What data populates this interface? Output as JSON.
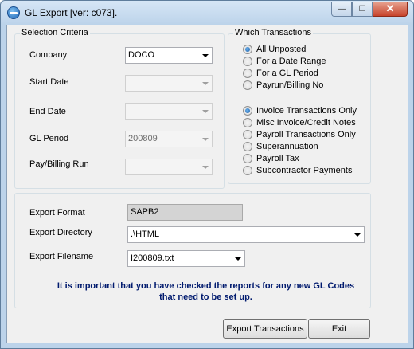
{
  "window": {
    "title": "GL Export [ver: c073].",
    "minimize_glyph": "—",
    "maximize_glyph": "☐",
    "close_glyph": "✕"
  },
  "selection_criteria": {
    "title": "Selection Criteria",
    "company_label": "Company",
    "company_value": "DOCO",
    "start_date_label": "Start Date",
    "start_date_value": "",
    "end_date_label": "End Date",
    "end_date_value": "",
    "gl_period_label": "GL Period",
    "gl_period_value": "200809",
    "pay_billing_run_label": "Pay/Billing Run",
    "pay_billing_run_value": ""
  },
  "which_transactions": {
    "title": "Which Transactions",
    "scope_options": [
      {
        "label": "All Unposted",
        "checked": true
      },
      {
        "label": "For a Date Range",
        "checked": false
      },
      {
        "label": "For a GL Period",
        "checked": false
      },
      {
        "label": "Payrun/Billing No",
        "checked": false
      }
    ],
    "type_options": [
      {
        "label": "Invoice Transactions Only",
        "checked": true
      },
      {
        "label": "Misc Invoice/Credit Notes",
        "checked": false
      },
      {
        "label": "Payroll Transactions Only",
        "checked": false
      },
      {
        "label": "Superannuation",
        "checked": false
      },
      {
        "label": "Payroll Tax",
        "checked": false
      },
      {
        "label": "Subcontractor Payments",
        "checked": false
      }
    ]
  },
  "export": {
    "format_label": "Export Format",
    "format_value": "SAPB2",
    "directory_label": "Export Directory",
    "directory_value": ".\\HTML",
    "filename_label": "Export Filename",
    "filename_value": "I200809.txt",
    "note_line1": "It is important that you have checked the reports for any new GL Codes",
    "note_line2": "that need to be set up."
  },
  "buttons": {
    "export_transactions": "Export Transactions",
    "exit": "Exit"
  }
}
